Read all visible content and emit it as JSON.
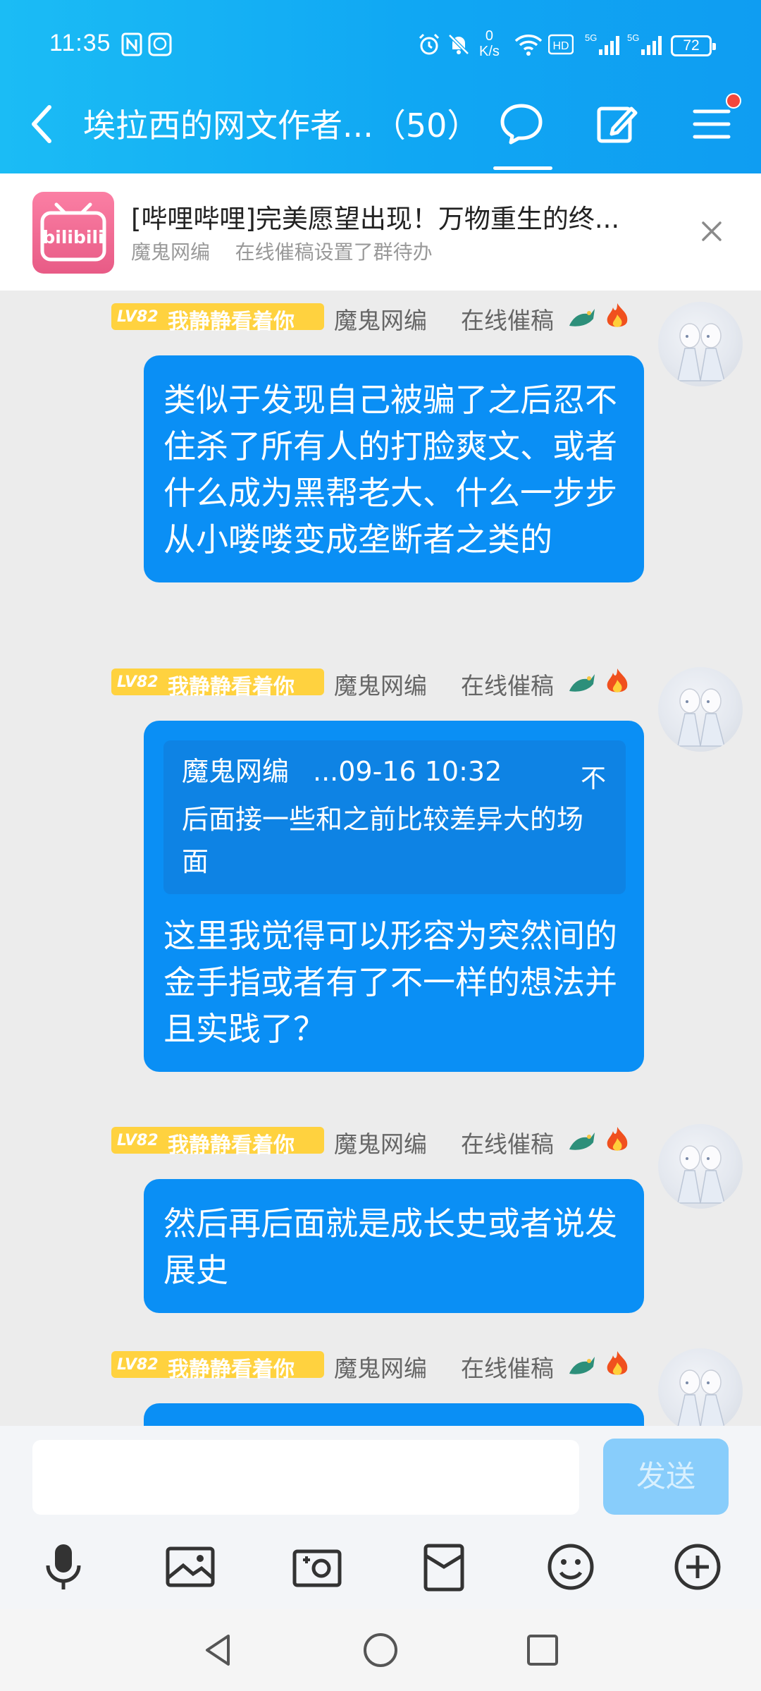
{
  "status_bar": {
    "time": "11:35",
    "net_speed_value": "0",
    "net_speed_unit": "K/s",
    "network_labels": [
      "HD",
      "5G",
      "5G"
    ],
    "battery": "72"
  },
  "header": {
    "title": "埃拉西的网文作者...（50）",
    "icons": [
      "back-icon",
      "chat-bubble-icon",
      "edit-icon",
      "menu-icon"
    ]
  },
  "banner": {
    "app_icon": "bilibili",
    "title": "[哔哩哔哩]完美愿望出现！万物重生的终...",
    "sender": "魔鬼网编",
    "action": "在线催稿设置了群待办"
  },
  "messages": [
    {
      "level": "LV82",
      "member_title": "我静静看着你",
      "sender": "魔鬼网编",
      "role": "在线催稿",
      "text": "类似于发现自己被骗了之后忍不住杀了所有人的打脸爽文、或者什么成为黑帮老大、什么一步步从小喽喽变成垄断者之类的"
    },
    {
      "level": "LV82",
      "member_title": "我静静看着你",
      "sender": "魔鬼网编",
      "role": "在线催稿",
      "quote": {
        "sender": "魔鬼网编",
        "time": "...09-16 10:32",
        "more": "不",
        "text": "后面接一些和之前比较差异大的场面"
      },
      "text": "这里我觉得可以形容为突然间的金手指或者有了不一样的想法并且实践了？"
    },
    {
      "level": "LV82",
      "member_title": "我静静看着你",
      "sender": "魔鬼网编",
      "role": "在线催稿",
      "text": "然后再后面就是成长史或者说发展史"
    },
    {
      "level": "LV82",
      "member_title": "我静静看着你",
      "sender": "魔鬼网编",
      "role": "在线催稿",
      "text": ""
    }
  ],
  "input_bar": {
    "value": "",
    "send_label": "发送",
    "tools": [
      "microphone-icon",
      "image-icon",
      "camera-icon",
      "red-packet-icon",
      "emoji-icon",
      "plus-icon"
    ]
  },
  "colors": {
    "header": "#12A9F4",
    "bubble": "#0A8FF5",
    "level_badge": "#FFD23F",
    "send_disabled": "#88CDFB"
  }
}
